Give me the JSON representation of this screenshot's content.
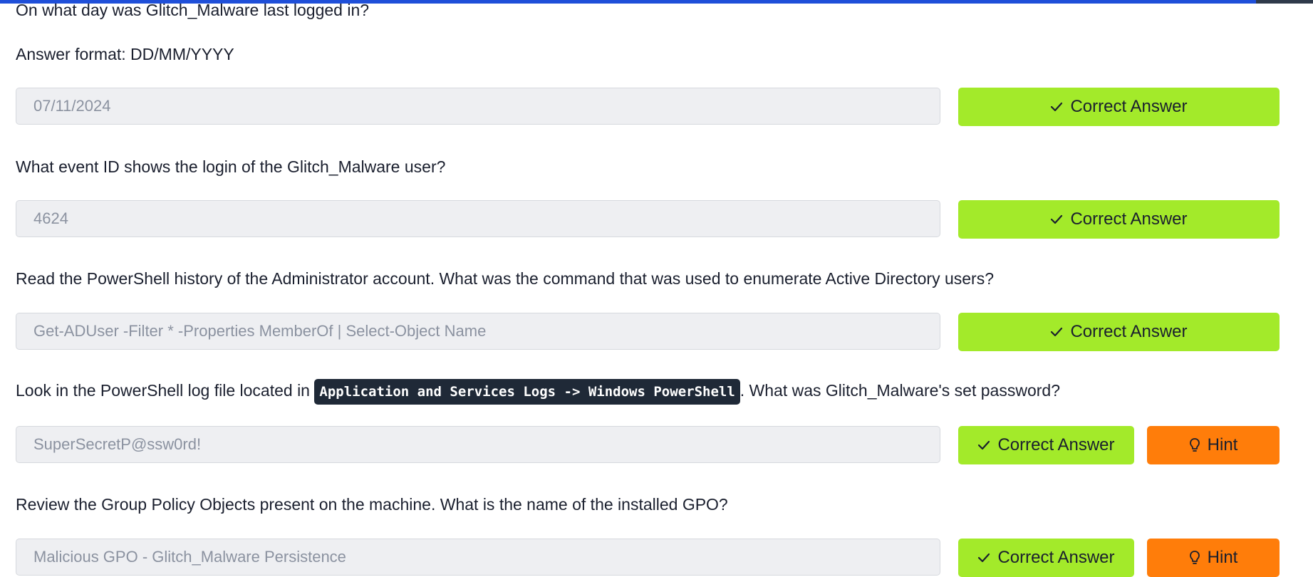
{
  "questions": [
    {
      "text": "On what day was Glitch_Malware last logged in?",
      "format": "Answer format: DD/MM/YYYY",
      "answer": "07/11/2024",
      "button": "Correct Answer"
    },
    {
      "text": "What event ID shows the login of the Glitch_Malware user?",
      "answer": "4624",
      "button": "Correct Answer"
    },
    {
      "text": "Read the PowerShell history of the Administrator account. What was the command that was used to enumerate Active Directory users?",
      "answer": "Get-ADUser -Filter * -Properties MemberOf | Select-Object Name",
      "button": "Correct Answer"
    },
    {
      "text_before": "Look in the PowerShell log file located in ",
      "code": "Application and Services Logs -> Windows PowerShell",
      "text_after": ". What was Glitch_Malware's set password?",
      "answer": "SuperSecretP@ssw0rd!",
      "button": "Correct Answer",
      "hint": "Hint"
    },
    {
      "text": "Review the Group Policy Objects present on the machine. What is the name of the installed GPO?",
      "answer": "Malicious GPO - Glitch_Malware Persistence",
      "button": "Correct Answer",
      "hint": "Hint"
    }
  ],
  "icons": {
    "check": "check-icon",
    "hint": "lightbulb-icon"
  },
  "colors": {
    "correct": "#a3ea2a",
    "hint": "#ff7d0a",
    "code_bg": "#1f2937",
    "input_bg": "#eeeff2",
    "topbar": "#1f4fd9"
  }
}
